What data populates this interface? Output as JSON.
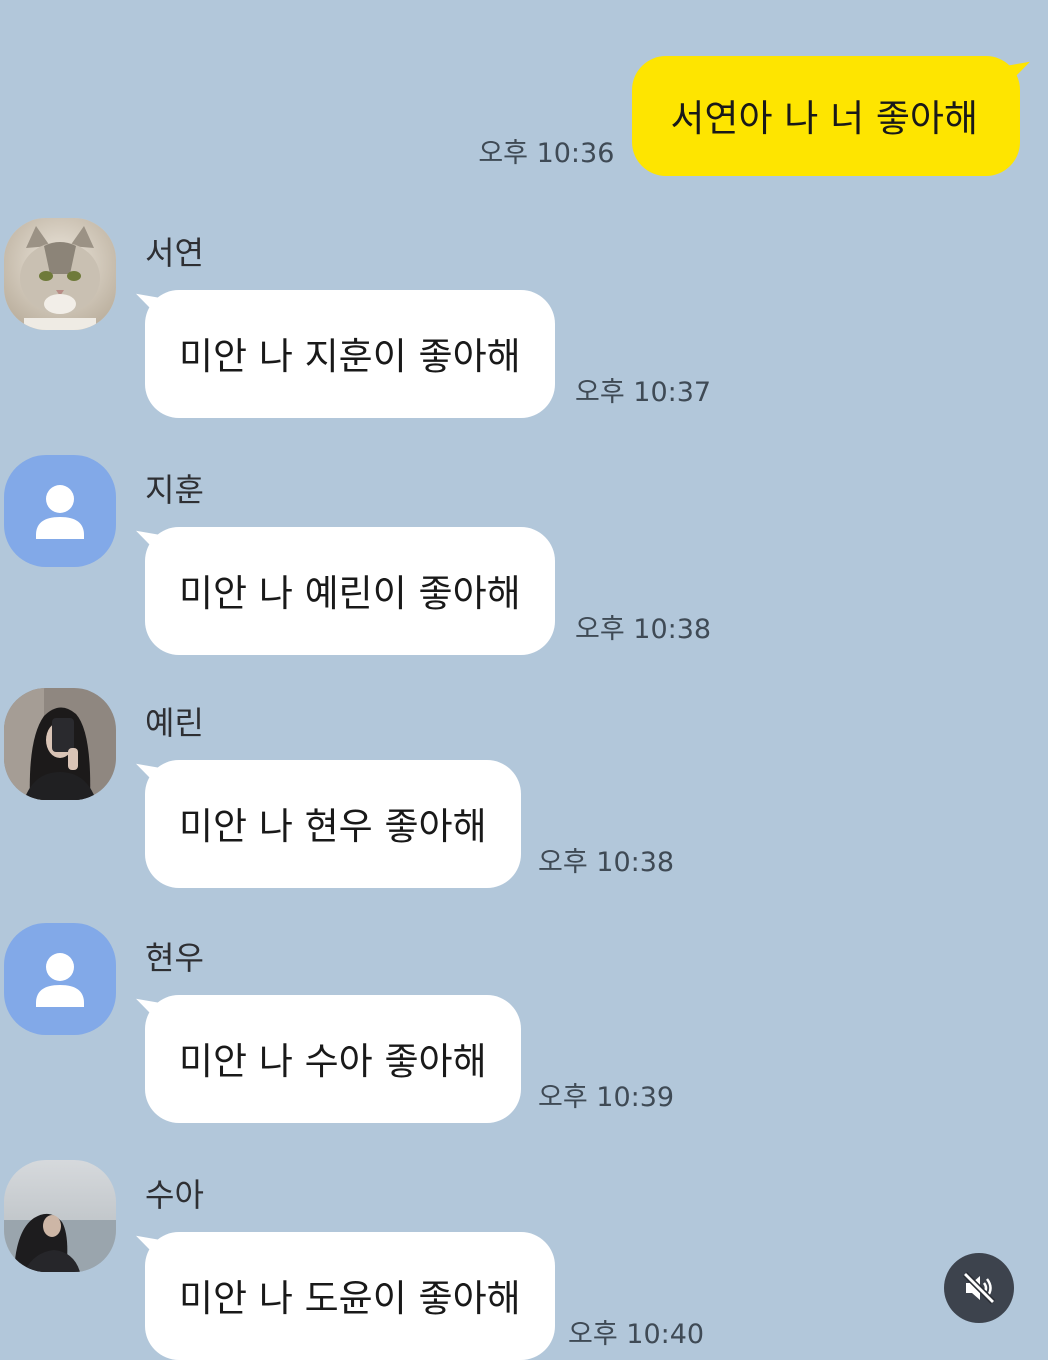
{
  "outgoing": {
    "text": "서연아 나 너 좋아해",
    "time": "오후 10:36",
    "bubble_color": "#fee500"
  },
  "messages": [
    {
      "sender": "서연",
      "text": "미안 나 지훈이 좋아해",
      "time": "오후 10:37",
      "avatar": "cat-photo"
    },
    {
      "sender": "지훈",
      "text": "미안 나 예린이 좋아해",
      "time": "오후 10:38",
      "avatar": "default-person-icon"
    },
    {
      "sender": "예린",
      "text": "미안 나 현우 좋아해",
      "time": "오후 10:38",
      "avatar": "selfie-photo"
    },
    {
      "sender": "현우",
      "text": "미안 나 수아 좋아해",
      "time": "오후 10:39",
      "avatar": "default-person-icon"
    },
    {
      "sender": "수아",
      "text": "미안 나 도윤이 좋아해",
      "time": "오후 10:40",
      "avatar": "seaside-photo"
    }
  ],
  "colors": {
    "background": "#b2c7da",
    "incoming_bubble": "#ffffff",
    "default_avatar": "#82a9e8"
  },
  "controls": {
    "mute_icon": "speaker-muted-icon"
  }
}
